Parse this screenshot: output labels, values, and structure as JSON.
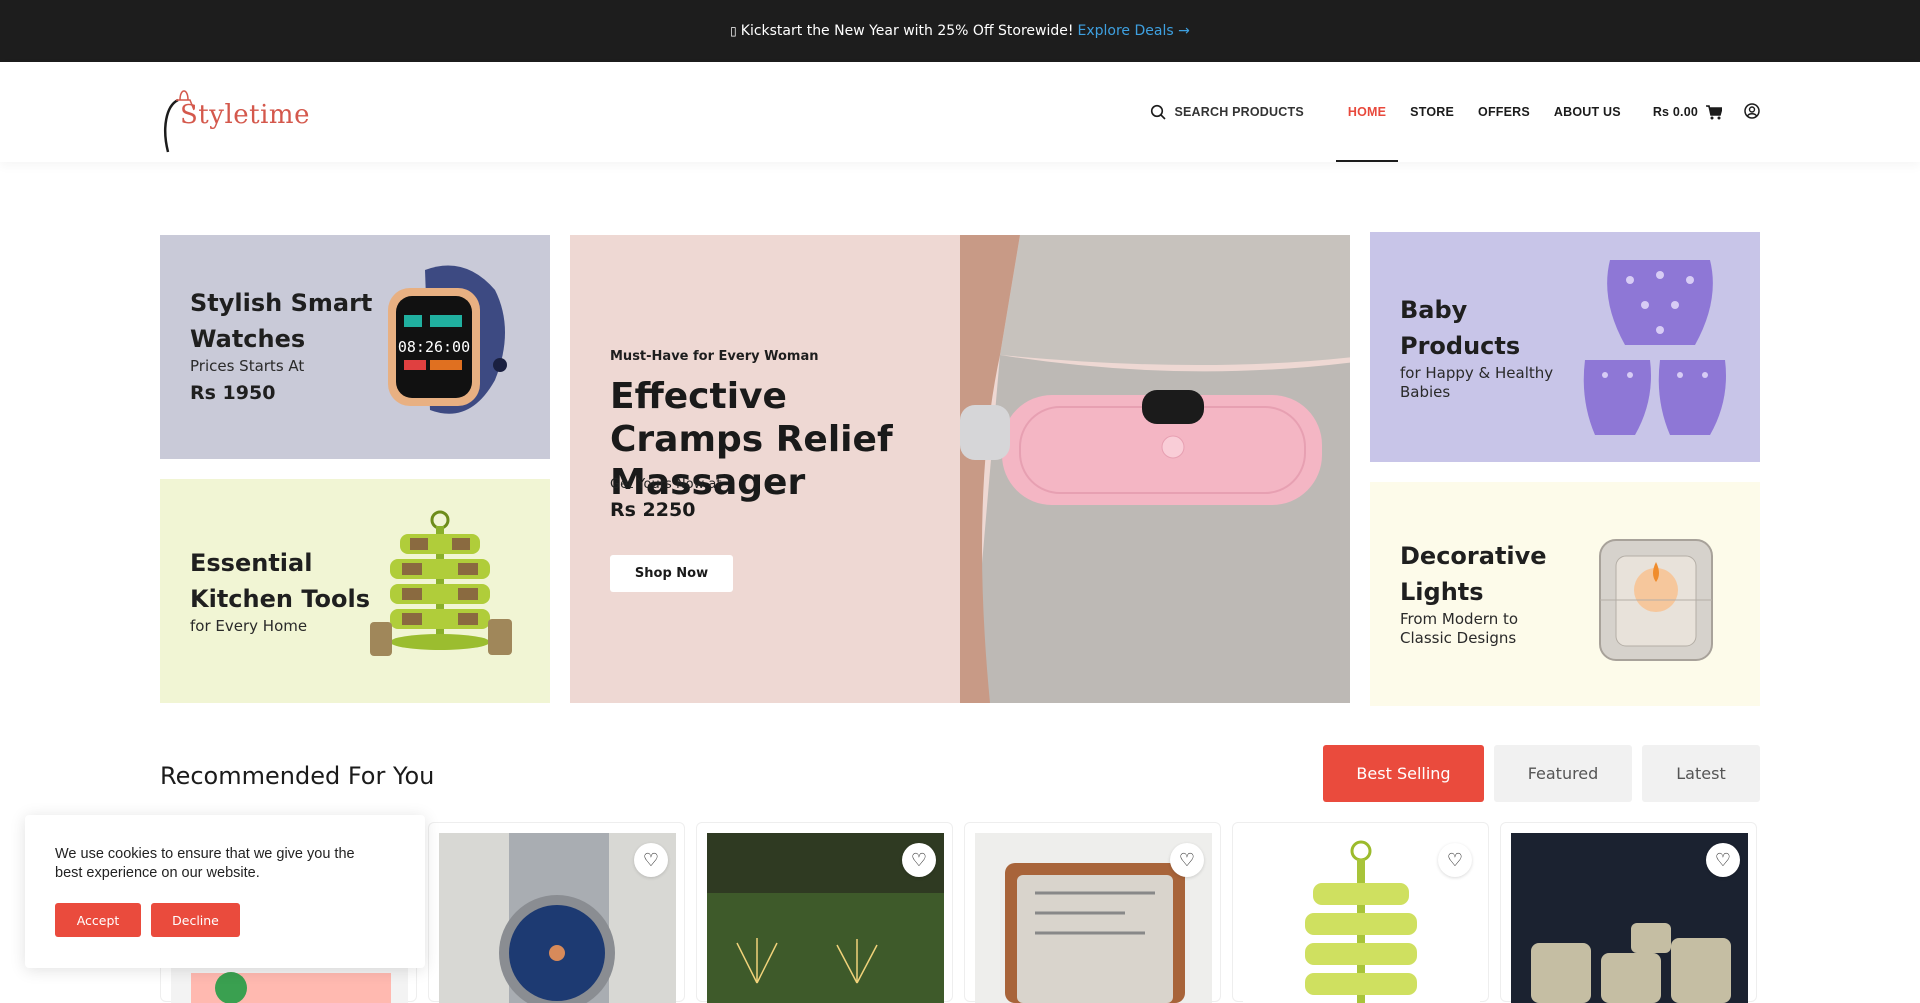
{
  "announcement": {
    "icon": "party-icon",
    "text": "Kickstart the New Year with 25% Off Storewide!",
    "link": "Explore Deals →"
  },
  "header": {
    "logo_text": "Styletime",
    "search_label": "SEARCH PRODUCTS",
    "nav": [
      "HOME",
      "STORE",
      "OFFERS",
      "ABOUT US"
    ],
    "active_nav": "HOME",
    "cart_total": "Rs 0.00"
  },
  "banners": {
    "watches": {
      "title_line1": "Stylish Smart",
      "title_line2": "Watches",
      "subtitle": "Prices Starts At",
      "price": "Rs 1950"
    },
    "kitchen": {
      "title_line1": "Essential",
      "title_line2": "Kitchen Tools",
      "subtitle": "for Every Home"
    },
    "hero": {
      "kicker": "Must-Have for Every Woman",
      "headline": "Effective Cramps Relief Massager",
      "prompt": "Get Yours Now at",
      "price": "Rs 2250",
      "button": "Shop Now"
    },
    "baby": {
      "title_line1": "Baby",
      "title_line2": "Products",
      "subtitle_line1": "for Happy & Healthy",
      "subtitle_line2": "Babies"
    },
    "lights": {
      "title_line1": "Decorative",
      "title_line2": "Lights",
      "subtitle_line1": "From Modern to",
      "subtitle_line2": "Classic Designs"
    }
  },
  "recommended": {
    "title": "Recommended For You",
    "tabs": [
      "Best Selling",
      "Featured",
      "Latest"
    ],
    "active_tab": "Best Selling"
  },
  "cookie": {
    "message": "We use cookies to ensure that we give you the best experience on our website.",
    "accept": "Accept",
    "decline": "Decline"
  },
  "colors": {
    "accent": "#ea4b3d",
    "topbar": "#1d1d1d",
    "link": "#3ea0e0"
  }
}
